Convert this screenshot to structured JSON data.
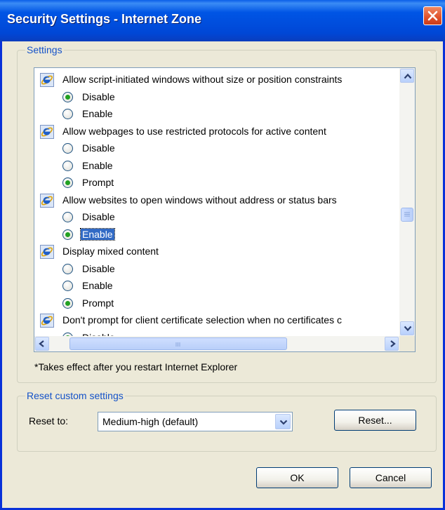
{
  "window": {
    "title": "Security Settings - Internet Zone"
  },
  "settings_group": {
    "label": "Settings",
    "rows": [
      {
        "kind": "heading",
        "text": "Allow script-initiated windows without size or position constraints"
      },
      {
        "kind": "option",
        "text": "Disable",
        "checked": true
      },
      {
        "kind": "option",
        "text": "Enable",
        "checked": false
      },
      {
        "kind": "heading",
        "text": "Allow webpages to use restricted protocols for active content"
      },
      {
        "kind": "option",
        "text": "Disable",
        "checked": false
      },
      {
        "kind": "option",
        "text": "Enable",
        "checked": false
      },
      {
        "kind": "option",
        "text": "Prompt",
        "checked": true
      },
      {
        "kind": "heading",
        "text": "Allow websites to open windows without address or status bars"
      },
      {
        "kind": "option",
        "text": "Disable",
        "checked": false
      },
      {
        "kind": "option",
        "text": "Enable",
        "checked": true,
        "selected": true
      },
      {
        "kind": "heading",
        "text": "Display mixed content"
      },
      {
        "kind": "option",
        "text": "Disable",
        "checked": false
      },
      {
        "kind": "option",
        "text": "Enable",
        "checked": false
      },
      {
        "kind": "option",
        "text": "Prompt",
        "checked": true
      },
      {
        "kind": "heading",
        "text": "Don't prompt for client certificate selection when no certificates c"
      },
      {
        "kind": "option",
        "text": "Disable",
        "checked": true
      }
    ],
    "note": "*Takes effect after you restart Internet Explorer"
  },
  "reset_group": {
    "label": "Reset custom settings",
    "reset_to_label": "Reset to:",
    "reset_to_value": "Medium-high (default)",
    "reset_button": "Reset..."
  },
  "buttons": {
    "ok": "OK",
    "cancel": "Cancel"
  },
  "icons": {
    "row_icon": "ie-icon",
    "close": "close-icon"
  },
  "colors": {
    "title_bar": "#0055e5",
    "selection": "#316ac5",
    "radio_dot": "#21a121"
  }
}
